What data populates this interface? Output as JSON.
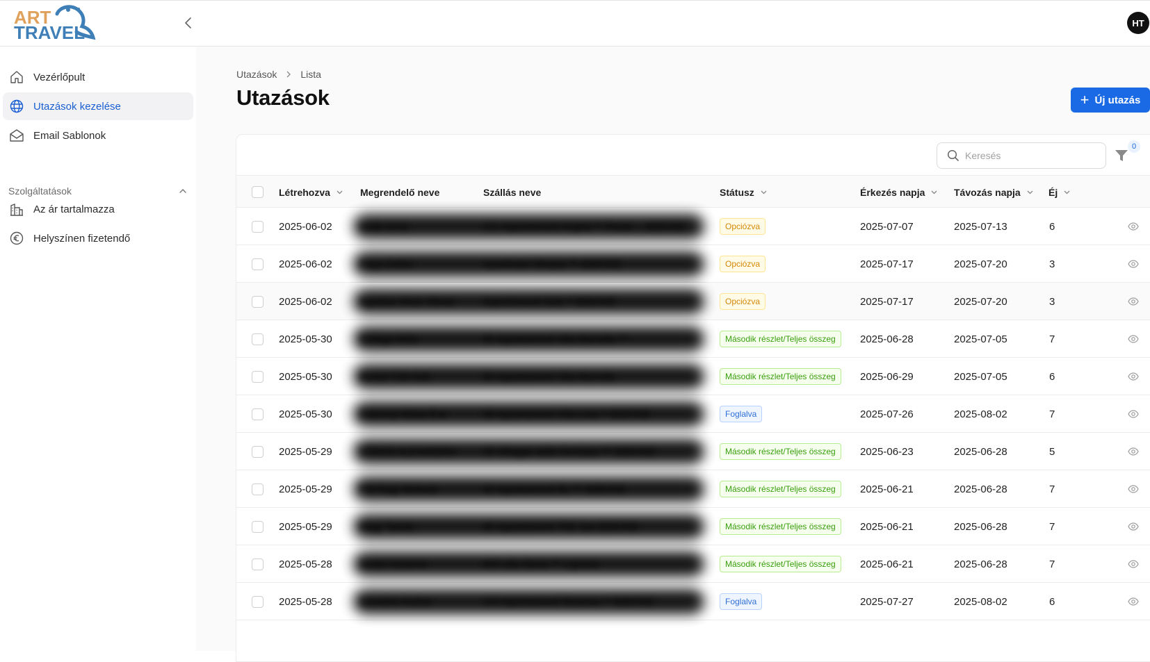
{
  "brand": {
    "line1": "ART",
    "line2": "TRAVEL",
    "colors": {
      "art": "#e0a15c",
      "travel": "#3f7fb8"
    }
  },
  "user": {
    "initials": "HT"
  },
  "sidebar": {
    "items": [
      {
        "label": "Vezérlőpult",
        "icon": "home-icon"
      },
      {
        "label": "Utazások kezelése",
        "icon": "globe-icon",
        "active": true
      },
      {
        "label": "Email Sablonok",
        "icon": "mail-icon"
      }
    ],
    "section": {
      "label": "Szolgáltatások",
      "expanded": true
    },
    "sub_items": [
      {
        "label": "Az ár tartalmazza",
        "icon": "building-icon"
      },
      {
        "label": "Helyszínen fizetendő",
        "icon": "euro-icon"
      }
    ]
  },
  "breadcrumb": {
    "items": [
      "Utazások",
      "Lista"
    ]
  },
  "page": {
    "title": "Utazások",
    "new_button": "Új utazás"
  },
  "toolbar": {
    "search_placeholder": "Keresés",
    "filter_count": "0"
  },
  "table": {
    "columns": [
      "Létrehozva",
      "Megrendelő neve",
      "Szállás neve",
      "Státusz",
      "Érkezés napja",
      "Távozás napja",
      "Éj"
    ],
    "rows": [
      {
        "created": "2025-06-02",
        "customer": "Izsák Anna",
        "accommodation": "101 Appartamenti Angelo ** Pineta ... BIBIONE",
        "status": "Opciózva",
        "status_type": "opt",
        "arrival": "2025-07-07",
        "departure": "2025-07-13",
        "nights": "6"
      },
      {
        "created": "2025-06-02",
        "customer": "Papp Zoltán",
        "accommodation": "ApartHotel Olimpia *** BIBIONE",
        "status": "Opciózva",
        "status_type": "opt",
        "arrival": "2025-07-17",
        "departure": "2025-07-20",
        "nights": "3"
      },
      {
        "created": "2025-06-02",
        "customer": "Agoston Vince Vilmos",
        "accommodation": "Appartamenti Sole ** BIBIONE",
        "status": "Opciózva",
        "status_type": "opt",
        "arrival": "2025-07-17",
        "departure": "2025-07-20",
        "nights": "3"
      },
      {
        "created": "2025-05-30",
        "customer": "Szilágyi Attila",
        "accommodation": "55 Appartamenti Villa Marcella ***",
        "status": "Második részlet/Teljes összeg",
        "status_type": "mas",
        "arrival": "2025-06-28",
        "departure": "2025-07-05",
        "nights": "7"
      },
      {
        "created": "2025-05-30",
        "customer": "Benkő-Tóth Edit",
        "accommodation": "50 Appartamenti Villa Marcella",
        "status": "Második részlet/Teljes összeg",
        "status_type": "mas",
        "arrival": "2025-06-29",
        "departure": "2025-07-05",
        "nights": "6"
      },
      {
        "created": "2025-05-30",
        "customer": "Dobronyi Márta Éva",
        "accommodation": "58 Appartamenti Villa Livia ** BIBIONE",
        "status": "Foglalva",
        "status_type": "fog",
        "arrival": "2025-07-26",
        "departure": "2025-08-02",
        "nights": "7"
      },
      {
        "created": "2025-05-29",
        "customer": "VÖRÖS ALEXANDRA",
        "accommodation": "33 Villaggio delle Orchidee *** BIBIONE",
        "status": "Második részlet/Teljes összeg",
        "status_type": "mas",
        "arrival": "2025-06-23",
        "departure": "2025-06-28",
        "nights": "5"
      },
      {
        "created": "2025-05-29",
        "customer": "Pál-Nagy Melinda",
        "accommodation": "42 Appartamenti Ifis *** BIBIONE",
        "status": "Második részlet/Teljes összeg",
        "status_type": "mas",
        "arrival": "2025-06-21",
        "departure": "2025-06-28",
        "nights": "7"
      },
      {
        "created": "2025-05-29",
        "customer": "Nagy Tamás",
        "accommodation": "45 Appartamenti TRE Sori BIBIONE",
        "status": "Második részlet/Teljes összeg",
        "status_type": "mas",
        "arrival": "2025-06-21",
        "departure": "2025-06-28",
        "nights": "7"
      },
      {
        "created": "2025-05-28",
        "customer": "Szabó Istvánné",
        "accommodation": "603 villa Gloria *** Lignano",
        "status": "Második részlet/Teljes összeg",
        "status_type": "mas",
        "arrival": "2025-06-21",
        "departure": "2025-06-28",
        "nights": "7"
      },
      {
        "created": "2025-05-28",
        "customer": "Szendrei András",
        "accommodation": "103 Appartamenti Massimo ** BIBIONE",
        "status": "Foglalva",
        "status_type": "fog",
        "arrival": "2025-07-27",
        "departure": "2025-08-02",
        "nights": "6"
      }
    ]
  }
}
